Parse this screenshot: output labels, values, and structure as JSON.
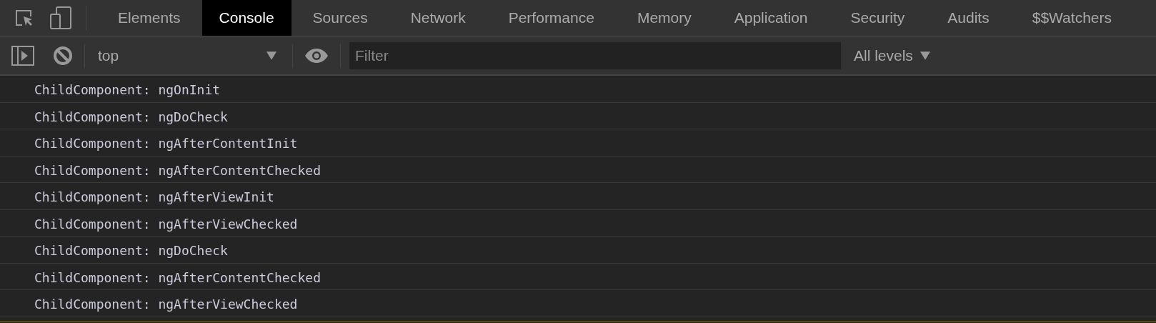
{
  "tabs": [
    {
      "label": "Elements",
      "selected": false
    },
    {
      "label": "Console",
      "selected": true
    },
    {
      "label": "Sources",
      "selected": false
    },
    {
      "label": "Network",
      "selected": false
    },
    {
      "label": "Performance",
      "selected": false
    },
    {
      "label": "Memory",
      "selected": false
    },
    {
      "label": "Application",
      "selected": false
    },
    {
      "label": "Security",
      "selected": false
    },
    {
      "label": "Audits",
      "selected": false
    },
    {
      "label": "$$Watchers",
      "selected": false
    }
  ],
  "toolbar": {
    "context": "top",
    "filter": {
      "placeholder": "Filter"
    },
    "levels": "All levels"
  },
  "messages": [
    "ChildComponent: ngOnInit",
    "ChildComponent: ngDoCheck",
    "ChildComponent: ngAfterContentInit",
    "ChildComponent: ngAfterContentChecked",
    "ChildComponent: ngAfterViewInit",
    "ChildComponent: ngAfterViewChecked",
    "ChildComponent: ngDoCheck",
    "ChildComponent: ngAfterContentChecked",
    "ChildComponent: ngAfterViewChecked"
  ]
}
